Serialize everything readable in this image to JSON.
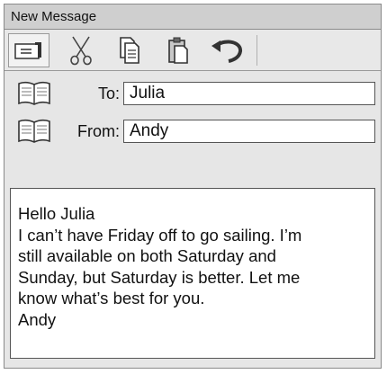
{
  "window": {
    "title": "New Message"
  },
  "toolbar": {
    "items": [
      {
        "name": "send",
        "icon": "send-icon"
      },
      {
        "name": "cut",
        "icon": "scissors-icon"
      },
      {
        "name": "copy",
        "icon": "copy-icon"
      },
      {
        "name": "paste",
        "icon": "paste-icon"
      },
      {
        "name": "undo",
        "icon": "undo-icon"
      }
    ]
  },
  "header": {
    "to": {
      "label": "To:",
      "value": "Julia",
      "icon": "address-book-icon"
    },
    "from": {
      "label": "From:",
      "value": "Andy",
      "icon": "address-book-icon"
    }
  },
  "message": {
    "body": "Hello Julia\nI can’t have Friday off to go sailing. I’m\nstill available on both Saturday and\nSunday, but Saturday is better. Let me\nknow what’s best for you.\nAndy"
  }
}
